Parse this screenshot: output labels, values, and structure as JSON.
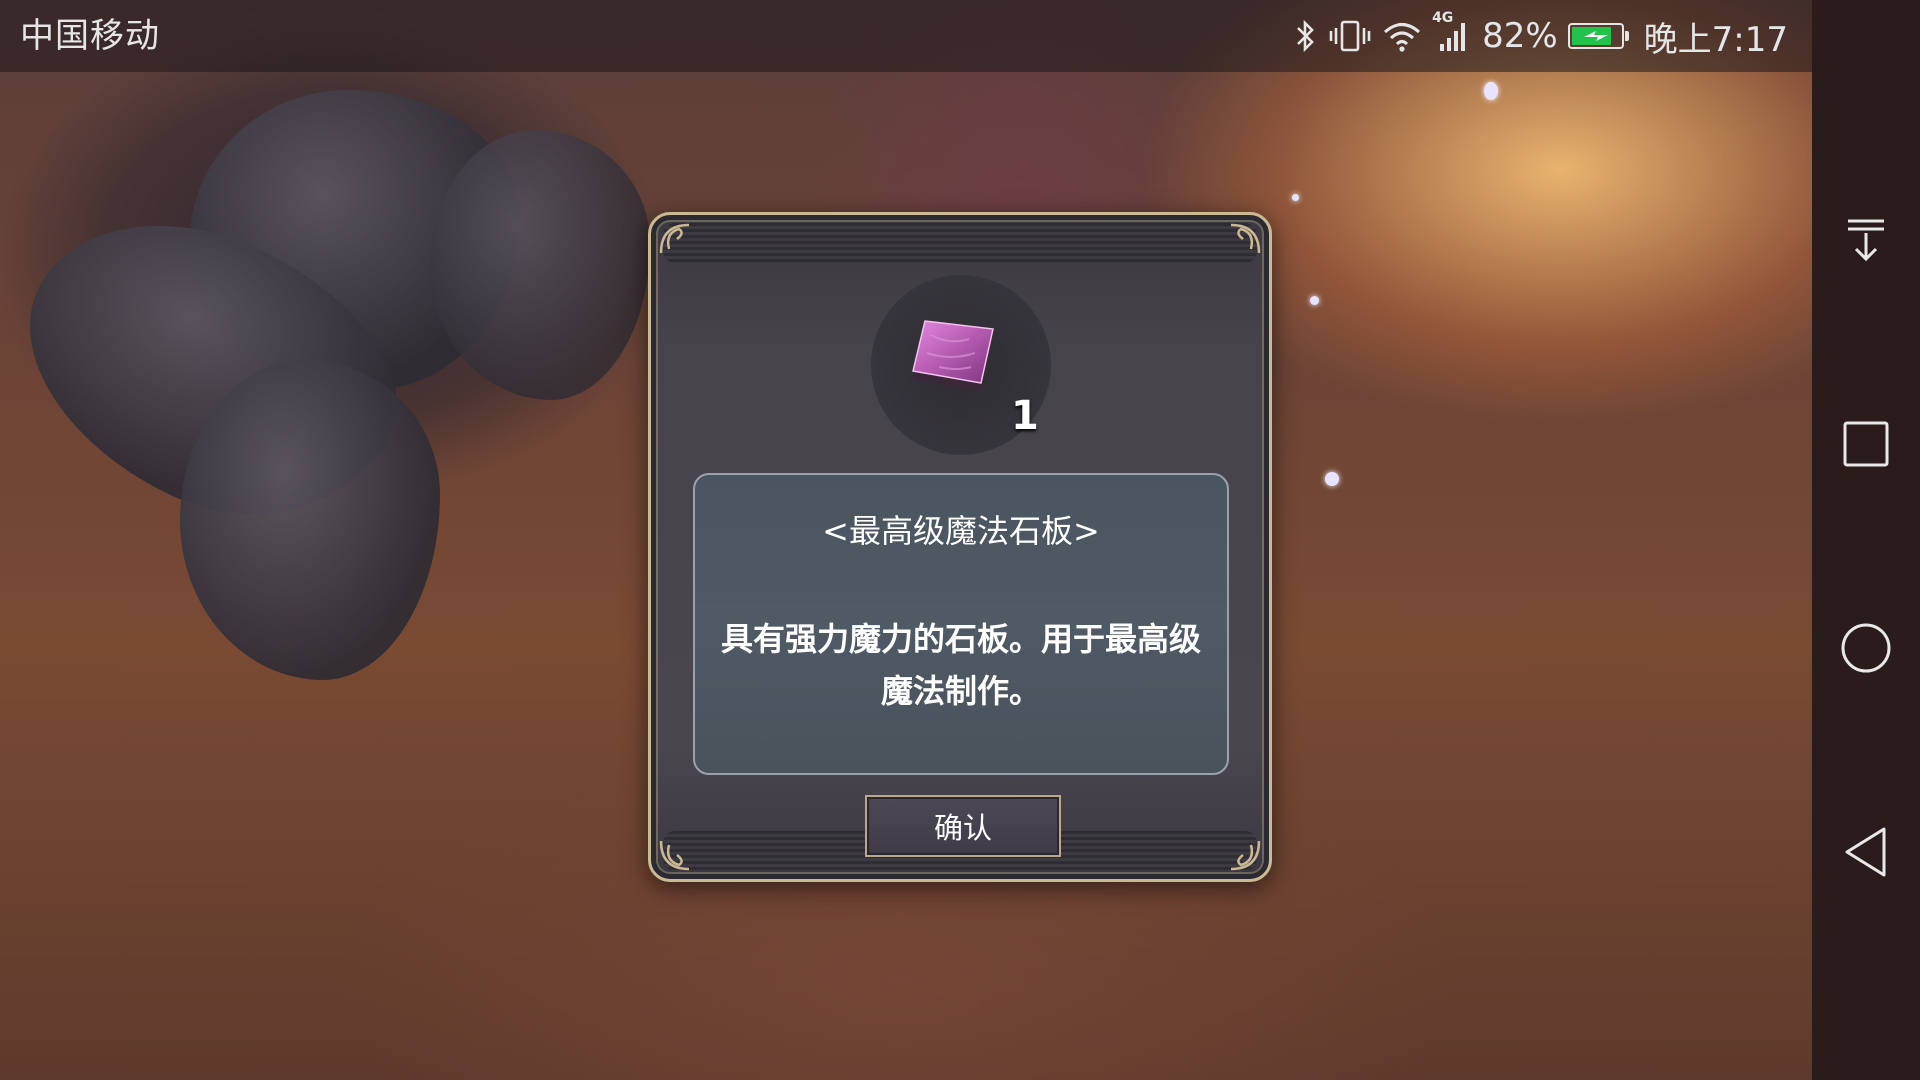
{
  "status_bar": {
    "carrier": "中国移动",
    "network_type": "4G",
    "battery_percent_text": "82%",
    "battery_level": 0.82,
    "time": "晚上7:17",
    "icons": [
      "bluetooth-icon",
      "vibrate-icon",
      "wifi-icon",
      "signal-icon",
      "battery-icon"
    ]
  },
  "dialog": {
    "item": {
      "icon": "magic-stone-slab-icon",
      "count": "1",
      "name": "<最高级魔法石板>",
      "description": "具有强力魔力的石板。用于最高级魔法制作。"
    },
    "confirm_label": "确认"
  },
  "nav_bar": {
    "buttons": [
      "notification-pull-down-icon",
      "recent-apps-icon",
      "home-icon",
      "back-icon"
    ]
  },
  "colors": {
    "dialog_border": "#c9b994",
    "info_box_bg": "#4e5862",
    "stone": "#b45bb0",
    "battery_fill": "#22c34a"
  }
}
